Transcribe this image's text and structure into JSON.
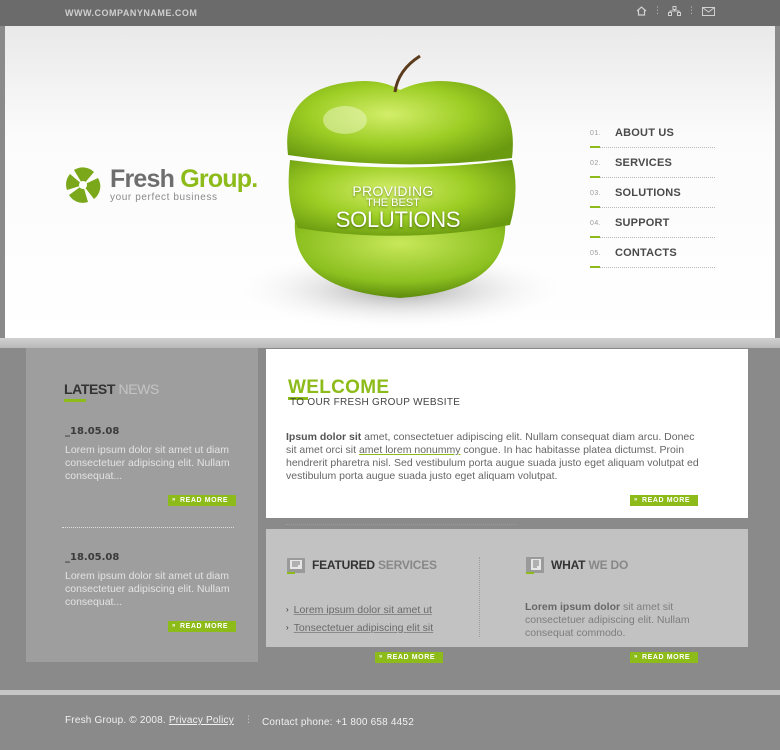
{
  "topbar": {
    "site_url": "WWW.COMPANYNAME.COM",
    "icons": [
      "home-icon",
      "sitemap-icon",
      "mail-icon"
    ]
  },
  "brand": {
    "name_part1": "Fresh",
    "name_part2": "Group.",
    "tagline": "your perfect business",
    "accent_color": "#8dbb1a"
  },
  "hero": {
    "line1": "PROVIDING",
    "line2": "THE BEST",
    "line3": "SOLUTIONS"
  },
  "nav": {
    "items": [
      {
        "num": "01.",
        "label": "ABOUT US"
      },
      {
        "num": "02.",
        "label": "SERVICES"
      },
      {
        "num": "03.",
        "label": "SOLUTIONS"
      },
      {
        "num": "04.",
        "label": "SUPPORT"
      },
      {
        "num": "05.",
        "label": "CONTACTS"
      }
    ]
  },
  "news": {
    "title_a": "LATEST",
    "title_b": "NEWS",
    "items": [
      {
        "date": "_18.05.08",
        "text": "Lorem ipsum dolor sit amet ut diam consectetuer adipiscing elit. Nullam consequat..."
      },
      {
        "date": "_18.05.08",
        "text": "Lorem ipsum dolor sit amet ut diam consectetuer adipiscing elit. Nullam consequat..."
      }
    ],
    "read_more": "READ MORE"
  },
  "welcome": {
    "title": "WELCOME",
    "subtitle": "TO OUR FRESH GROUP WEBSITE",
    "lead": "Ipsum dolor sit",
    "text1": " amet, consectetuer adipiscing elit. Nullam consequat diam arcu. Donec sit amet orci sit ",
    "link": "amet lorem nonummy",
    "text2": " congue. In hac habitasse platea dictumst. Proin hendrerit pharetra nisl. Sed vestibulum porta augue suada justo eget aliquam volutpat ed vestibulum porta augue suada justo eget aliquam volutpat.",
    "read_more": "READ MORE"
  },
  "featured": {
    "title_a": "FEATURED",
    "title_b": "SERVICES",
    "items": [
      "Lorem ipsum dolor sit amet ut",
      "Tonsectetuer adipiscing elit sit"
    ],
    "read_more": "READ MORE"
  },
  "whatwedo": {
    "title_a": "WHAT",
    "title_b": "WE DO",
    "lead": "Lorem ipsum dolor",
    "text": " sit amet sit consectetuer adipiscing elit. Nullam consequat commodo.",
    "read_more": "READ MORE"
  },
  "footer": {
    "copyright": "Fresh Group. © 2008.",
    "privacy": "Privacy Policy",
    "separator": "⋮",
    "contact": "Contact phone: +1 800 658 4452"
  }
}
